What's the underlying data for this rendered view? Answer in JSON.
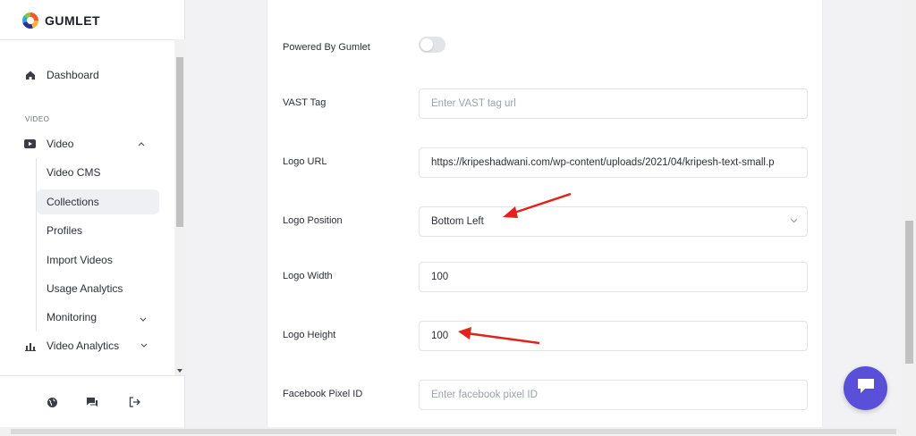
{
  "brand": {
    "name": "GUMLET"
  },
  "sidebar": {
    "dashboard_label": "Dashboard",
    "section_video": "VIDEO",
    "video_label": "Video",
    "sub_items": [
      "Video CMS",
      "Collections",
      "Profiles",
      "Import Videos",
      "Usage Analytics",
      "Monitoring"
    ],
    "video_analytics_label": "Video Analytics",
    "active_sub_item": "Collections"
  },
  "form": {
    "powered_by_label": "Powered By Gumlet",
    "powered_by_enabled": false,
    "vast_label": "VAST Tag",
    "vast_placeholder": "Enter VAST tag url",
    "logo_url_label": "Logo URL",
    "logo_url_value": "https://kripeshadwani.com/wp-content/uploads/2021/04/kripesh-text-small.p",
    "logo_position_label": "Logo Position",
    "logo_position_value": "Bottom Left",
    "logo_width_label": "Logo Width",
    "logo_width_value": "100",
    "logo_height_label": "Logo Height",
    "logo_height_value": "100",
    "fb_pixel_label": "Facebook Pixel ID",
    "fb_pixel_placeholder": "Enter facebook pixel ID"
  },
  "colors": {
    "accent": "#5a4fd9",
    "annotation": "#e0231c"
  },
  "icons": [
    "home-icon",
    "youtube-icon",
    "bar-chart-icon",
    "globe-icon",
    "chat-icon",
    "logout-icon"
  ]
}
